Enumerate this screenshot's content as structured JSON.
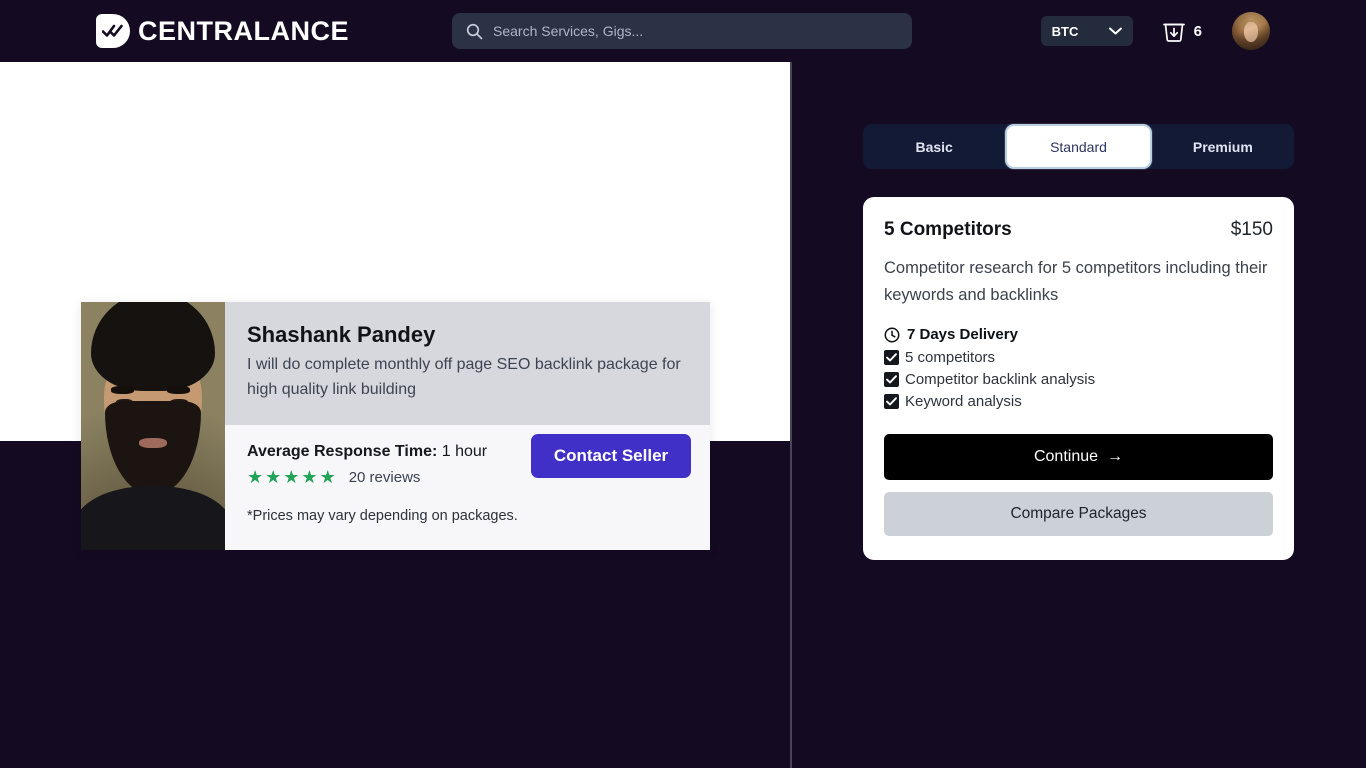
{
  "header": {
    "brand_name": "CENTRALANCE",
    "brand_icon": "double-check-badge-icon",
    "search": {
      "icon": "search-icon",
      "placeholder": "Search Services, Gigs...",
      "value": ""
    },
    "currency": {
      "selected": "BTC",
      "icon": "chevron-down-icon"
    },
    "cart": {
      "icon": "basket-download-icon",
      "count": "6"
    },
    "avatar": "user-avatar"
  },
  "seller_card": {
    "photo_alt": "seller-photo",
    "name": "Shashank Pandey",
    "description": "I will do complete monthly off page SEO backlink package for high quality link building",
    "response_label": "Average Response Time:",
    "response_value": "1 hour",
    "stars": 5,
    "star_glyph": "★",
    "star_color": "#22a358",
    "reviews": "20 reviews",
    "price_note": "*Prices may vary depending on packages.",
    "contact_button": "Contact Seller",
    "contact_button_color": "#4130c8"
  },
  "packages": {
    "tabs": [
      {
        "label": "Basic",
        "active": false
      },
      {
        "label": "Standard",
        "active": true
      },
      {
        "label": "Premium",
        "active": false
      }
    ],
    "card": {
      "title": "5 Competitors",
      "price": "$150",
      "description": "Competitor research for 5 competitors including their keywords and backlinks",
      "delivery_icon": "clock-icon",
      "delivery": "7 Days Delivery",
      "features": [
        "5 competitors",
        "Competitor backlink analysis",
        "Keyword analysis"
      ],
      "continue_button": "Continue",
      "continue_arrow": "→",
      "compare_button": "Compare Packages"
    }
  },
  "colors": {
    "page_background": "#140a22",
    "header_background": "#140a22",
    "accent": "#4130c8",
    "tab_bar": "#131a35",
    "star": "#22a358"
  }
}
